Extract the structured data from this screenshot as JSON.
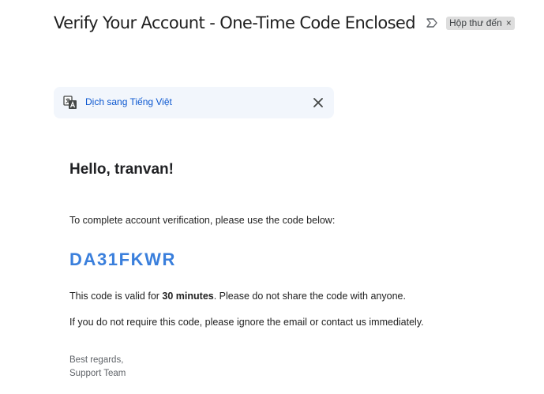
{
  "header": {
    "subject": "Verify Your Account - One-Time Code Enclosed",
    "label_chip": "Hộp thư đến",
    "label_remove": "×",
    "importance_icon": "importance-marker-icon"
  },
  "translate_bar": {
    "icon": "translate-icon",
    "link": "Dịch sang Tiếng Việt",
    "close_icon": "close-icon"
  },
  "email_body": {
    "greeting": "Hello, tranvan!",
    "intro": "To complete account verification, please use the code below:",
    "code": "DA31FKWR",
    "validity_prefix": "This code is valid for ",
    "validity_duration": "30 minutes",
    "validity_suffix": ". Please do not share the code with anyone.",
    "ignore_notice": "If you do not require this code, please ignore the email or contact us immediately.",
    "signoff": "Best regards,",
    "signature": "Support Team"
  },
  "colors": {
    "code": "#3a7fdc",
    "link": "#0b57d0",
    "translate_bar_bg": "#f2f6fc",
    "chip_bg": "#dddddd"
  }
}
